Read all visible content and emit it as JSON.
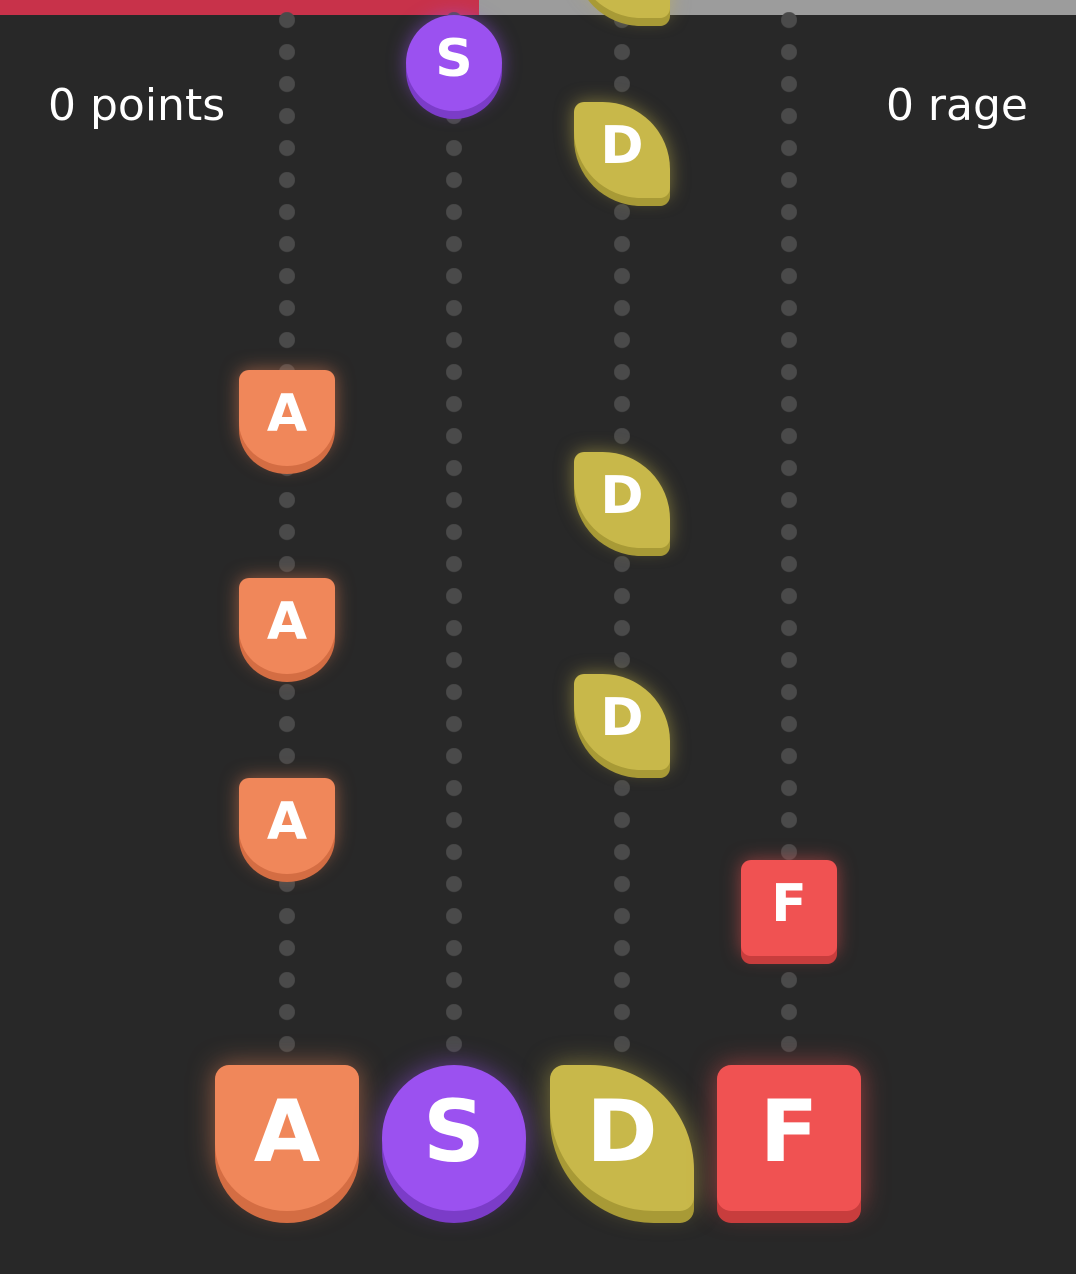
{
  "hud": {
    "points_label": "0 points",
    "rage_label": "0 rage"
  },
  "progress": {
    "fraction": 0.445,
    "fill_color": "#c8324a",
    "track_color": "#9c9c9c"
  },
  "lanes": [
    {
      "key": "A",
      "shape": "drop-bottom",
      "color": "#f0875a",
      "shadow": "#d46d43",
      "glow": "rgba(240,135,90,0.55)"
    },
    {
      "key": "S",
      "shape": "circle",
      "color": "#9b51f0",
      "shadow": "#7b3cc8",
      "glow": "rgba(155,81,240,0.55)"
    },
    {
      "key": "D",
      "shape": "leaf",
      "color": "#c8b84a",
      "shadow": "#a89a36",
      "glow": "rgba(200,184,74,0.55)"
    },
    {
      "key": "F",
      "shape": "square",
      "color": "#f05252",
      "shadow": "#c83d3d",
      "glow": "rgba(240,82,82,0.55)"
    }
  ],
  "notes": [
    {
      "lane": 2,
      "label": "D",
      "partial": true
    },
    {
      "lane": 1,
      "label": "S"
    },
    {
      "lane": 2,
      "label": "D"
    },
    {
      "lane": 0,
      "label": "A"
    },
    {
      "lane": 2,
      "label": "D"
    },
    {
      "lane": 0,
      "label": "A"
    },
    {
      "lane": 2,
      "label": "D"
    },
    {
      "lane": 0,
      "label": "A"
    },
    {
      "lane": 3,
      "label": "F"
    }
  ],
  "keys": [
    {
      "lane": 0,
      "label": "A"
    },
    {
      "lane": 1,
      "label": "S"
    },
    {
      "lane": 2,
      "label": "D"
    },
    {
      "lane": 3,
      "label": "F"
    }
  ]
}
